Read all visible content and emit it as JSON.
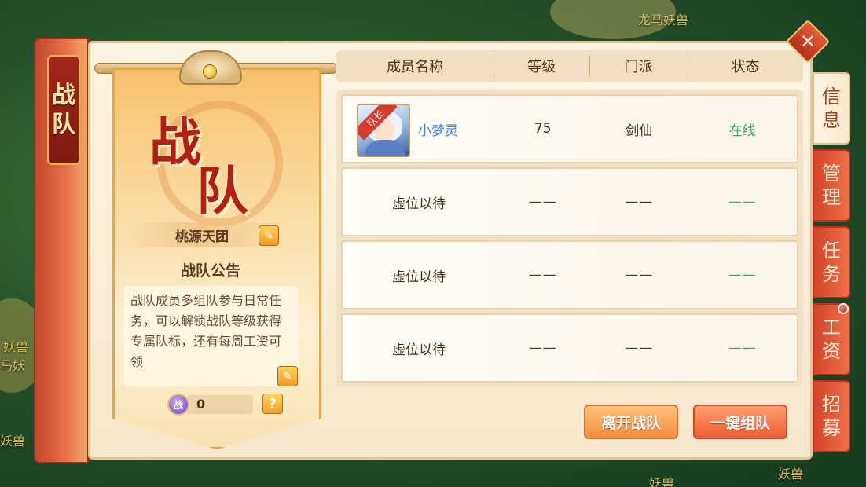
{
  "background": {
    "labels": [
      "龙马妖兽",
      "妖兽",
      "马妖",
      "妖兽",
      "妖兽",
      "妖兽"
    ]
  },
  "left_tab": {
    "chars": [
      "战",
      "队"
    ]
  },
  "banner": {
    "title_chars": [
      "战",
      "队"
    ],
    "team_name": "桃源天团",
    "notice_title": "战队公告",
    "notice_text": "战队成员多组队参与日常任务，可以解锁战队等级获得专属队标，还有每周工资可领",
    "coin_icon_label": "战",
    "coin_value": "0",
    "help_label": "?"
  },
  "table": {
    "headers": [
      "成员名称",
      "等级",
      "门派",
      "状态"
    ],
    "rows": [
      {
        "leader_tag": "队长",
        "name": "小梦灵",
        "level": "75",
        "school": "剑仙",
        "status": "在线"
      },
      {
        "name": "虚位以待",
        "level": "——",
        "school": "——",
        "status": "——"
      },
      {
        "name": "虚位以待",
        "level": "——",
        "school": "——",
        "status": "——"
      },
      {
        "name": "虚位以待",
        "level": "——",
        "school": "——",
        "status": "——"
      }
    ]
  },
  "buttons": {
    "leave": "离开战队",
    "quick_team": "一键组队"
  },
  "right_tabs": [
    {
      "chars": [
        "信",
        "息"
      ],
      "active": true
    },
    {
      "chars": [
        "管",
        "理"
      ],
      "active": false
    },
    {
      "chars": [
        "任",
        "务"
      ],
      "active": false
    },
    {
      "chars": [
        "工",
        "资"
      ],
      "active": false,
      "badge": true
    },
    {
      "chars": [
        "招",
        "募"
      ],
      "active": false
    }
  ],
  "colors": {
    "accent_red": "#d6442a",
    "online_green": "#3aa860",
    "member_blue": "#3c86d6"
  },
  "icons": [
    "close-icon",
    "edit-icon",
    "help-icon",
    "coin-icon",
    "avatar-image"
  ]
}
